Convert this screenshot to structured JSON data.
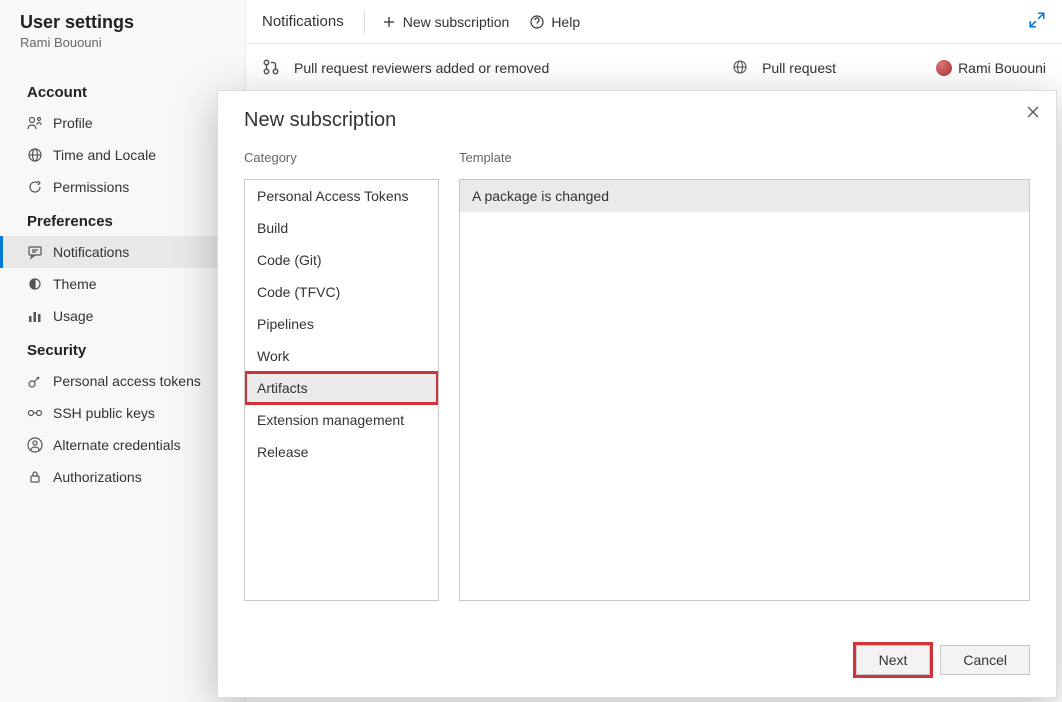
{
  "sidebar": {
    "title": "User settings",
    "user": "Rami Bououni",
    "sections": [
      {
        "label": "Account",
        "items": [
          {
            "label": "Profile",
            "icon": "profile-icon"
          },
          {
            "label": "Time and Locale",
            "icon": "globe-icon"
          },
          {
            "label": "Permissions",
            "icon": "refresh-icon"
          }
        ]
      },
      {
        "label": "Preferences",
        "items": [
          {
            "label": "Notifications",
            "icon": "chat-icon",
            "active": true
          },
          {
            "label": "Theme",
            "icon": "theme-icon"
          },
          {
            "label": "Usage",
            "icon": "bar-chart-icon"
          }
        ]
      },
      {
        "label": "Security",
        "items": [
          {
            "label": "Personal access tokens",
            "icon": "key-icon"
          },
          {
            "label": "SSH public keys",
            "icon": "ssh-icon"
          },
          {
            "label": "Alternate credentials",
            "icon": "credentials-icon"
          },
          {
            "label": "Authorizations",
            "icon": "lock-icon"
          }
        ]
      }
    ]
  },
  "header": {
    "title": "Notifications",
    "new_subscription": "New subscription",
    "help": "Help"
  },
  "bg_row": {
    "desc": "Pull request reviewers added or removed",
    "col2": "Pull request",
    "col3": "Rami Bououni"
  },
  "dialog": {
    "title": "New subscription",
    "category_label": "Category",
    "template_label": "Template",
    "categories": [
      "Personal Access Tokens",
      "Build",
      "Code (Git)",
      "Code (TFVC)",
      "Pipelines",
      "Work",
      "Artifacts",
      "Extension management",
      "Release"
    ],
    "selected_category_index": 6,
    "templates": [
      "A package is changed"
    ],
    "selected_template_index": 0,
    "next": "Next",
    "cancel": "Cancel"
  }
}
